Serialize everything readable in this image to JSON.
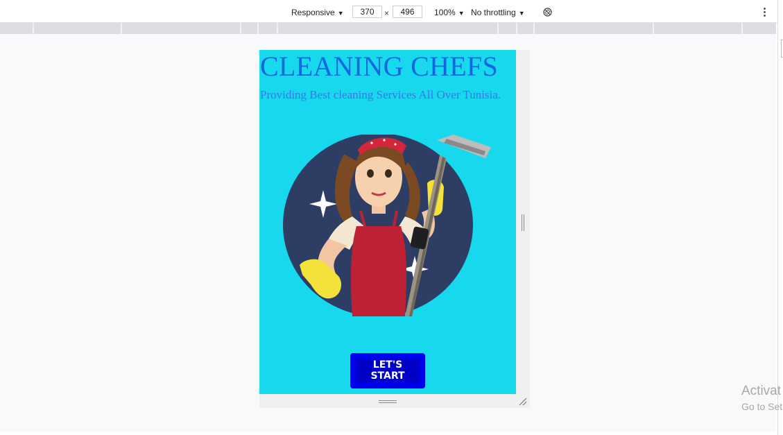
{
  "toolbar": {
    "device": "Responsive",
    "width": "370",
    "times": "×",
    "height": "496",
    "zoom": "100%",
    "throttling": "No throttling"
  },
  "page": {
    "title": "CLEANING CHEFS",
    "subtitle": "Providing Best cleaning Services All Over Tunisia.",
    "cta_label": "LET'S START"
  },
  "watermark": {
    "line1": "Activat",
    "line2": "Go to Set"
  },
  "colors": {
    "page_background": "#17d8ec",
    "title": "#1068e0",
    "button": "#0000f0"
  },
  "icons": {
    "dropdown": "caret-down-icon",
    "rotate": "rotate-disabled-icon",
    "menu": "more-vertical-icon",
    "resize": "resize-grip-icon"
  }
}
